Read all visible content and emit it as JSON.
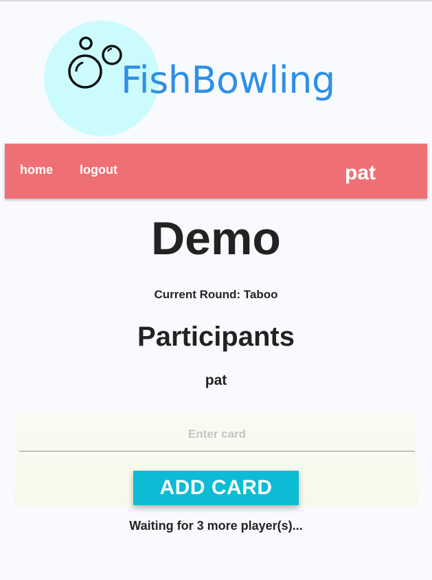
{
  "logo": {
    "text": "FishBowling",
    "circle_color": "#ccfbfd",
    "text_color": "#2f8fe6",
    "icon": "bubbles-icon"
  },
  "navbar": {
    "home_label": "home",
    "logout_label": "logout",
    "username": "pat",
    "color": "#ef7074"
  },
  "game": {
    "title": "Demo",
    "current_round": "Current Round: Taboo"
  },
  "participants": {
    "heading": "Participants",
    "names": [
      "pat"
    ]
  },
  "card_form": {
    "placeholder": "Enter card",
    "value": "",
    "button_label": "ADD CARD",
    "button_color": "#0bbcd4"
  },
  "status": {
    "waiting": "Waiting for 3 more player(s)..."
  }
}
